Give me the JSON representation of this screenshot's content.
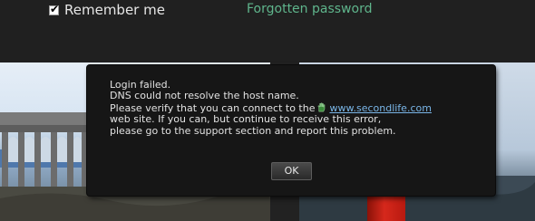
{
  "login": {
    "remember_me_label": "Remember me",
    "remember_me_checked": true,
    "forgot_password_link": "Forgotten password"
  },
  "dialog": {
    "lines": [
      "Login failed.",
      "DNS could not resolve the host name.",
      "Please verify that you can connect to the",
      "web site.  If you can, but continue to receive this error,",
      "please go to the support section and report this problem."
    ],
    "link_text": "www.secondlife.com",
    "link_icon": "hand-icon",
    "ok_button_label": "OK"
  },
  "colors": {
    "link_green": "#5fb58c",
    "url_blue": "#7ab6e8",
    "dialog_bg": "#161616"
  }
}
